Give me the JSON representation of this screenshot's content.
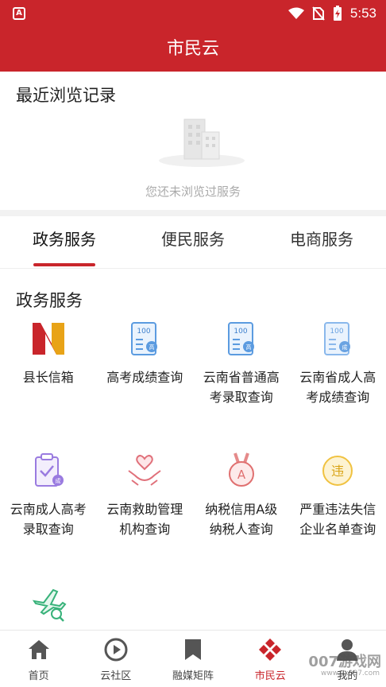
{
  "statusbar": {
    "app_badge": "A",
    "time": "5:53"
  },
  "header": {
    "title": "市民云"
  },
  "recent": {
    "title": "最近浏览记录",
    "empty_text": "您还未浏览过服务"
  },
  "tabs": [
    {
      "label": "政务服务",
      "active": true
    },
    {
      "label": "便民服务",
      "active": false
    },
    {
      "label": "电商服务",
      "active": false
    }
  ],
  "section": {
    "title": "政务服务"
  },
  "services": [
    {
      "label": "县长信箱",
      "icon": "logo-n-icon"
    },
    {
      "label": "高考成绩查询",
      "icon": "score-report-icon"
    },
    {
      "label": "云南省普通高考录取查询",
      "icon": "score-report-icon"
    },
    {
      "label": "云南省成人高考成绩查询",
      "icon": "score-report-icon"
    },
    {
      "label": "云南成人高考录取查询",
      "icon": "clipboard-check-icon"
    },
    {
      "label": "云南救助管理机构查询",
      "icon": "hands-heart-icon"
    },
    {
      "label": "纳税信用A级纳税人查询",
      "icon": "medal-a-icon"
    },
    {
      "label": "严重违法失信企业名单查询",
      "icon": "violation-icon"
    },
    {
      "label": "",
      "icon": "plane-search-icon"
    }
  ],
  "bottom_nav": [
    {
      "label": "首页",
      "icon": "home-icon",
      "active": false
    },
    {
      "label": "云社区",
      "icon": "play-circle-icon",
      "active": false
    },
    {
      "label": "融媒矩阵",
      "icon": "bookmark-icon",
      "active": false
    },
    {
      "label": "市民云",
      "icon": "diamond-cluster-icon",
      "active": true
    },
    {
      "label": "我的",
      "icon": "user-icon",
      "active": false
    }
  ],
  "watermark": {
    "text": "007游戏网",
    "sub": "www.yx007.com"
  },
  "colors": {
    "brand": "#c9252b",
    "divider": "#f2f2f2",
    "muted": "#aaaaaa"
  }
}
